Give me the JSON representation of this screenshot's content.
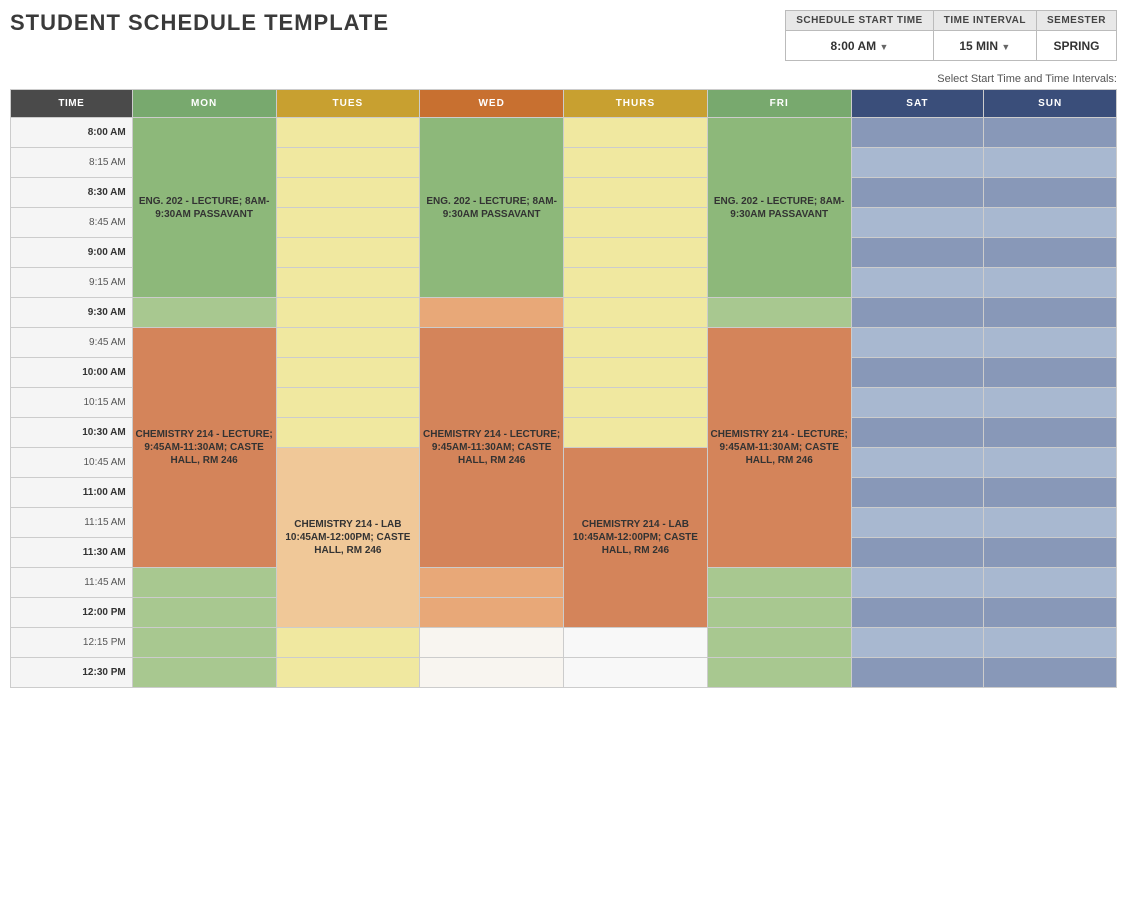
{
  "title": "STUDENT SCHEDULE TEMPLATE",
  "controls": {
    "select_label": "Select Start Time and Time Intervals:",
    "col1_header": "SCHEDULE START TIME",
    "col2_header": "TIME INTERVAL",
    "col3_header": "SEMESTER",
    "start_time": "8:00 AM",
    "time_interval": "15 MIN",
    "semester": "SPRING"
  },
  "grid": {
    "headers": {
      "time": "TIME",
      "mon": "MON",
      "tues": "TUES",
      "wed": "WED",
      "thurs": "THURS",
      "fri": "FRI",
      "sat": "SAT",
      "sun": "SUN"
    },
    "events": {
      "eng202": "ENG. 202 - LECTURE; 8AM-9:30AM PASSAVANT",
      "chem214_lecture_mon": "CHEMISTRY 214 - LECTURE; 9:45AM-11:30AM; CASTE HALL, RM 246",
      "chem214_lab_tues": "CHEMISTRY 214 - LAB 10:45AM-12:00PM; CASTE HALL, RM 246",
      "chem214_lecture_wed": "CHEMISTRY 214 - LECTURE; 9:45AM-11:30AM; CASTE HALL, RM 246",
      "chem214_lab_thurs": "CHEMISTRY 214 - LAB 10:45AM-12:00PM; CASTE HALL, RM 246",
      "chem214_lecture_fri": "CHEMISTRY 214 - LECTURE; 9:45AM-11:30AM; CASTE HALL, RM 246"
    },
    "times": [
      "8:00 AM",
      "8:15 AM",
      "8:30 AM",
      "8:45 AM",
      "9:00 AM",
      "9:15 AM",
      "9:30 AM",
      "9:45 AM",
      "10:00 AM",
      "10:15 AM",
      "10:30 AM",
      "10:45 AM",
      "11:00 AM",
      "11:15 AM",
      "11:30 AM",
      "11:45 AM",
      "12:00 PM",
      "12:15 PM",
      "12:30 PM"
    ]
  }
}
